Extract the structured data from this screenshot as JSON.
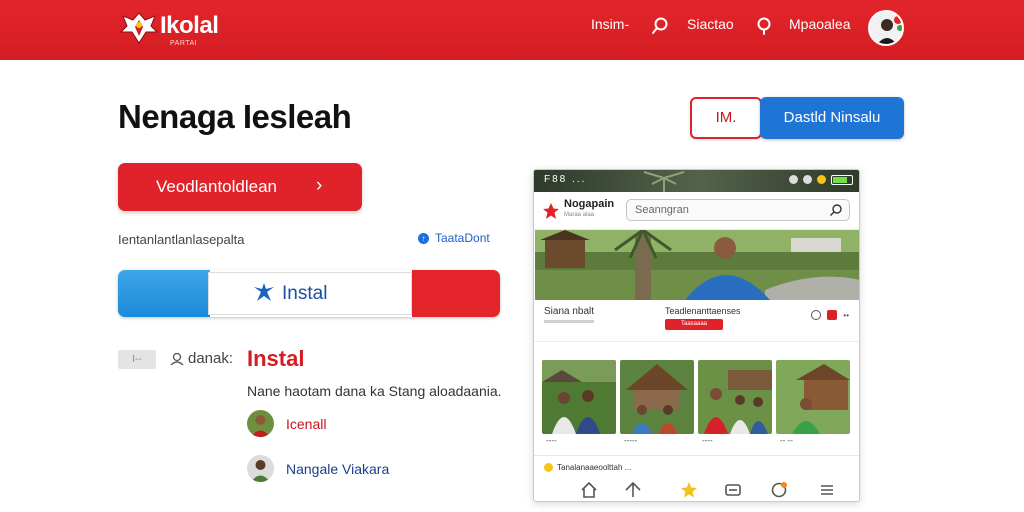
{
  "header": {
    "brand": "Ikolal",
    "brand_sub": "PARTAI",
    "nav": [
      {
        "label": "Insim-"
      },
      {
        "label": "Siactao"
      },
      {
        "label": "Mpaoalea"
      }
    ]
  },
  "main": {
    "title": "Nenaga Iesleah",
    "primary_button": "Veodlantoldlean",
    "helper_text": "Ientanlantlanlasepalta",
    "info_link": "TaataDont",
    "install_label": "Instal",
    "mini_chip": "I--",
    "sub_label": "danak:",
    "instal_heading": "Instal",
    "description": "Nane haotam dana ka Stang aloadaania.",
    "people": [
      {
        "name": "Icenall"
      },
      {
        "name": "Nangale Viakara"
      }
    ]
  },
  "actions": {
    "outline_button": "IM.",
    "blue_button": "Dastld Ninsalu"
  },
  "phone": {
    "status_left": "F88 ...",
    "app_name": "Nogapain",
    "app_sub": "Maraa alaa",
    "search_placeholder": "Seanngran",
    "meta_title": "Siana nbalt",
    "meta_center": "Teadlenanttaenses",
    "meta_button": "Taasaaaa",
    "thumb_captions": [
      "----",
      "-----",
      "----",
      "-- --"
    ],
    "notice": "Tanalanaaeoolttah ..."
  },
  "colors": {
    "brand_red": "#e3252b",
    "accent_blue": "#1f75d6"
  }
}
